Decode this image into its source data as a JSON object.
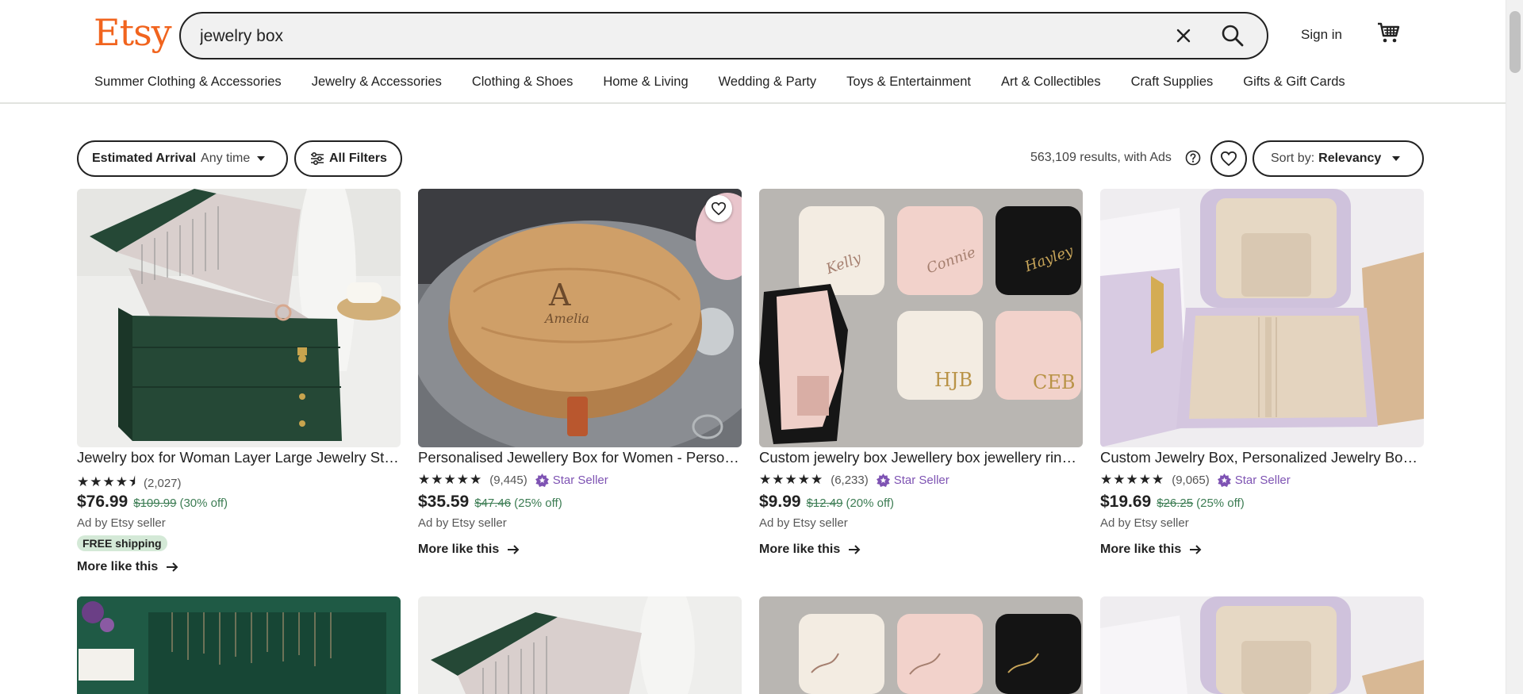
{
  "header": {
    "logo": "Etsy",
    "search_value": "jewelry box",
    "sign_in": "Sign in",
    "categories": [
      "Summer Clothing & Accessories",
      "Jewelry & Accessories",
      "Clothing & Shoes",
      "Home & Living",
      "Wedding & Party",
      "Toys & Entertainment",
      "Art & Collectibles",
      "Craft Supplies",
      "Gifts & Gift Cards"
    ]
  },
  "filters": {
    "arrival_label": "Estimated Arrival",
    "arrival_value": "Any time",
    "all_filters": "All Filters",
    "results": "563,109 results, with Ads",
    "sort_label": "Sort by:",
    "sort_value": "Relevancy"
  },
  "listings": [
    {
      "title": "Jewelry box for Woman Layer Large Jewelry Storage Box",
      "rating": 4.5,
      "reviews": "(2,027)",
      "star_seller": "",
      "price": "$76.99",
      "original": "$109.99",
      "discount": "(30% off)",
      "seller": "Ad by Etsy seller",
      "shipping": "FREE shipping",
      "more": "More like this"
    },
    {
      "title": "Personalised Jewellery Box for Women - Personalised Gift",
      "rating": 5,
      "reviews": "(9,445)",
      "star_seller": "Star Seller",
      "price": "$35.59",
      "original": "$47.46",
      "discount": "(25% off)",
      "seller": "Ad by Etsy seller",
      "shipping": "",
      "more": "More like this"
    },
    {
      "title": "Custom jewelry box Jewellery box jewellery ring box",
      "rating": 5,
      "reviews": "(6,233)",
      "star_seller": "Star Seller",
      "price": "$9.99",
      "original": "$12.49",
      "discount": "(20% off)",
      "seller": "Ad by Etsy seller",
      "shipping": "",
      "more": "More like this"
    },
    {
      "title": "Custom Jewelry Box, Personalized Jewelry Box, Travel",
      "rating": 5,
      "reviews": "(9,065)",
      "star_seller": "Star Seller",
      "price": "$19.69",
      "original": "$26.25",
      "discount": "(25% off)",
      "seller": "Ad by Etsy seller",
      "shipping": "",
      "more": "More like this"
    }
  ],
  "image_text": {
    "monogram": "A",
    "script_name": "Amelia",
    "names": [
      "Kelly",
      "Connie",
      "Hayley"
    ],
    "initials": [
      "HJB",
      "CEB"
    ]
  },
  "colors": {
    "brand": "#f1641e",
    "star_seller": "#7e53b3",
    "discount": "#3d7d54",
    "shipping_bg": "#d4e9d7"
  }
}
